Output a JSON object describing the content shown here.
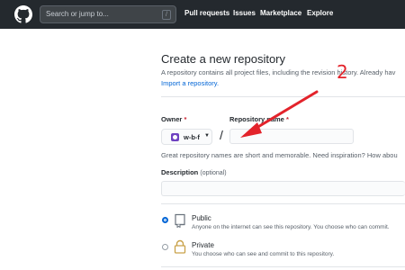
{
  "header": {
    "search_placeholder": "Search or jump to...",
    "search_shortcut": "/",
    "nav": [
      "Pull requests",
      "Issues",
      "Marketplace",
      "Explore"
    ]
  },
  "page": {
    "title": "Create a new repository",
    "subtitle": "A repository contains all project files, including the revision history. Already hav",
    "import_link": "Import a repository."
  },
  "form": {
    "owner_label": "Owner",
    "owner_value": "w-b-f",
    "separator": "/",
    "repo_label": "Repository name",
    "required_mark": "*",
    "hint": "Great repository names are short and memorable. Need inspiration? How abou",
    "description_label": "Description",
    "description_optional": "(optional)"
  },
  "visibility": [
    {
      "title": "Public",
      "desc": "Anyone on the internet can see this repository. You choose who can commit.",
      "selected": true,
      "icon": "repo-icon"
    },
    {
      "title": "Private",
      "desc": "You choose who can see and commit to this repository.",
      "selected": false,
      "icon": "lock-icon"
    }
  ],
  "annotation": {
    "number": "2",
    "color": "#e3232b"
  }
}
